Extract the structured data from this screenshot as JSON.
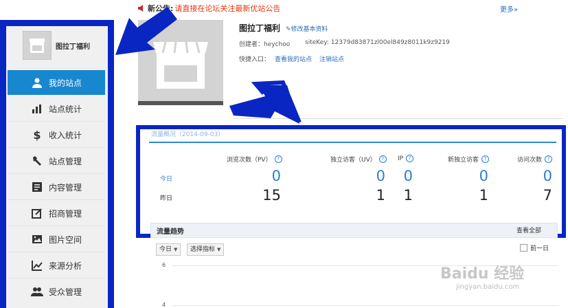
{
  "announcement": {
    "label": "新公告:",
    "text": "请直接在论坛关注最新优站公告",
    "more": "更多»"
  },
  "sidebar": {
    "site_name": "图拉丁福利",
    "items": [
      {
        "label": "我的站点",
        "icon": "user-icon",
        "active": true
      },
      {
        "label": "站点统计",
        "icon": "bar-chart-icon"
      },
      {
        "label": "收入统计",
        "icon": "dollar-icon"
      },
      {
        "label": "站点管理",
        "icon": "wrench-icon"
      },
      {
        "label": "内容管理",
        "icon": "document-icon"
      },
      {
        "label": "招商管理",
        "icon": "edit-box-icon"
      },
      {
        "label": "图片空间",
        "icon": "image-icon"
      },
      {
        "label": "来源分析",
        "icon": "trend-line-icon"
      },
      {
        "label": "受众管理",
        "icon": "users-icon"
      }
    ]
  },
  "site": {
    "title": "图拉丁福利",
    "edit_link": "修改基本资料",
    "creator": "创建者：heychoo",
    "sitekey": "siteKey: 12379d83871zl00el849z8011k9z9219",
    "shortcut_label": "快捷入口：",
    "view_link": "查看我的站点",
    "cancel_link": "注销站点"
  },
  "stats": {
    "section_title": "流量概况（2014-09-03）",
    "columns": [
      "浏览次数（PV）",
      "独立访客（UV）",
      "IP",
      "新独立访客",
      "访问次数"
    ],
    "rows": [
      {
        "label": "今日",
        "values": [
          "0",
          "0",
          "0",
          "0",
          "0"
        ]
      },
      {
        "label": "昨日",
        "values": [
          "15",
          "1",
          "1",
          "1",
          "7"
        ]
      }
    ]
  },
  "trend": {
    "title": "流量趋势",
    "view_all": "查看全部",
    "day_select": "今日",
    "metric_select": "选择指标",
    "prev_day": "前一日",
    "y_ticks": [
      "6",
      "4"
    ]
  },
  "watermark": {
    "brand": "Baidu 经验",
    "url": "jingyan.baidu.com"
  },
  "colors": {
    "accent_blue": "#1787d0",
    "annotation_blue": "#0a26c2",
    "notice_red": "#e8380d",
    "link_blue": "#2a6ebb"
  }
}
